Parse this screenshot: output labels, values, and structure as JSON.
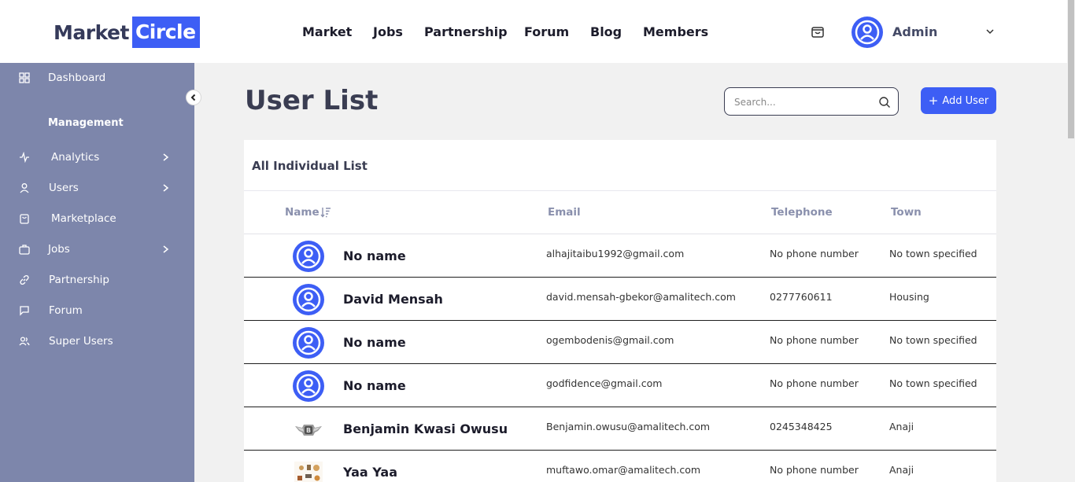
{
  "logo": {
    "part1": "Market",
    "part2": "Circle"
  },
  "nav": [
    "Market",
    "Jobs",
    "Partnership",
    "Forum",
    "Blog",
    "Members"
  ],
  "header": {
    "user_name": "Admin"
  },
  "sidebar": {
    "heading": "Management",
    "items": [
      {
        "label": "Dashboard",
        "icon": "grid-icon"
      },
      {
        "label": "Analytics",
        "icon": "activity-icon"
      },
      {
        "label": "Users",
        "icon": "user-icon"
      },
      {
        "label": "Marketplace",
        "icon": "bag-icon"
      },
      {
        "label": "Jobs",
        "icon": "briefcase-icon"
      },
      {
        "label": "Partnership",
        "icon": "link-icon"
      },
      {
        "label": "Forum",
        "icon": "message-icon"
      },
      {
        "label": "Super Users",
        "icon": "users-icon"
      }
    ]
  },
  "main": {
    "title": "User List",
    "search_placeholder": "Search...",
    "add_label": "Add User",
    "card_title": "All Individual List",
    "columns": {
      "name": "Name",
      "email": "Email",
      "phone": "Telephone",
      "town": "Town"
    },
    "rows": [
      {
        "name": "No name",
        "email": "alhajitaibu1992@gmail.com",
        "phone": "No phone number",
        "town": "No town specified",
        "avatar": "default-avatar"
      },
      {
        "name": "David Mensah",
        "email": "david.mensah-gbekor@amalitech.com",
        "phone": "0277760611",
        "town": "Housing",
        "avatar": "default-avatar"
      },
      {
        "name": "No name",
        "email": "ogembodenis@gmail.com",
        "phone": "No phone number",
        "town": "No town specified",
        "avatar": "default-avatar"
      },
      {
        "name": "No name",
        "email": "godfidence@gmail.com",
        "phone": "No phone number",
        "town": "No town specified",
        "avatar": "default-avatar"
      },
      {
        "name": "Benjamin Kwasi Owusu",
        "email": "Benjamin.owusu@amalitech.com",
        "phone": "0245348425",
        "town": "Anaji",
        "avatar": "car-logo-photo"
      },
      {
        "name": "Yaa Yaa",
        "email": "muftawo.omar@amalitech.com",
        "phone": "No phone number",
        "town": "Anaji",
        "avatar": "items-photo"
      }
    ]
  },
  "colors": {
    "accent": "#3d5ef5",
    "sidebar": "#7d86ab",
    "title": "#3a3d52"
  }
}
